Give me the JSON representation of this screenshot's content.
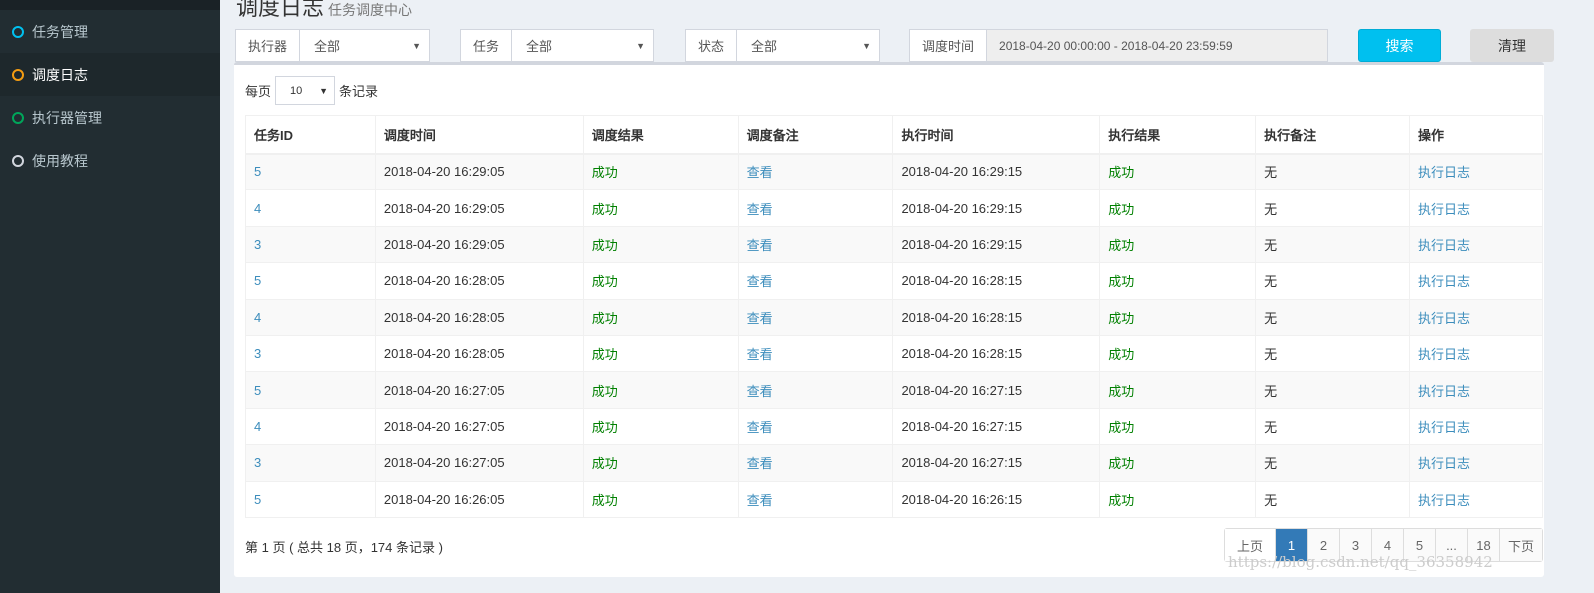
{
  "sidebar": {
    "items": [
      {
        "label": "任务管理",
        "color": "#00c0ef"
      },
      {
        "label": "调度日志",
        "color": "#f39c12"
      },
      {
        "label": "执行器管理",
        "color": "#00a65a"
      },
      {
        "label": "使用教程",
        "color": "#d2d6de"
      }
    ]
  },
  "header": {
    "title": "调度日志",
    "subtitle": "任务调度中心"
  },
  "filters": {
    "executor_label": "执行器",
    "executor_value": "全部",
    "job_label": "任务",
    "job_value": "全部",
    "status_label": "状态",
    "status_value": "全部",
    "time_label": "调度时间",
    "time_value": "2018-04-20 00:00:00 - 2018-04-20 23:59:59",
    "search": "搜索",
    "clear": "清理"
  },
  "page_size": {
    "prefix": "每页",
    "value": "10",
    "suffix": "条记录"
  },
  "table": {
    "headers": [
      "任务ID",
      "调度时间",
      "调度结果",
      "调度备注",
      "执行时间",
      "执行结果",
      "执行备注",
      "操作"
    ],
    "rows": [
      [
        "5",
        "2018-04-20 16:29:05",
        "成功",
        "查看",
        "2018-04-20 16:29:15",
        "成功",
        "无",
        "执行日志"
      ],
      [
        "4",
        "2018-04-20 16:29:05",
        "成功",
        "查看",
        "2018-04-20 16:29:15",
        "成功",
        "无",
        "执行日志"
      ],
      [
        "3",
        "2018-04-20 16:29:05",
        "成功",
        "查看",
        "2018-04-20 16:29:15",
        "成功",
        "无",
        "执行日志"
      ],
      [
        "5",
        "2018-04-20 16:28:05",
        "成功",
        "查看",
        "2018-04-20 16:28:15",
        "成功",
        "无",
        "执行日志"
      ],
      [
        "4",
        "2018-04-20 16:28:05",
        "成功",
        "查看",
        "2018-04-20 16:28:15",
        "成功",
        "无",
        "执行日志"
      ],
      [
        "3",
        "2018-04-20 16:28:05",
        "成功",
        "查看",
        "2018-04-20 16:28:15",
        "成功",
        "无",
        "执行日志"
      ],
      [
        "5",
        "2018-04-20 16:27:05",
        "成功",
        "查看",
        "2018-04-20 16:27:15",
        "成功",
        "无",
        "执行日志"
      ],
      [
        "4",
        "2018-04-20 16:27:05",
        "成功",
        "查看",
        "2018-04-20 16:27:15",
        "成功",
        "无",
        "执行日志"
      ],
      [
        "3",
        "2018-04-20 16:27:05",
        "成功",
        "查看",
        "2018-04-20 16:27:15",
        "成功",
        "无",
        "执行日志"
      ],
      [
        "5",
        "2018-04-20 16:26:05",
        "成功",
        "查看",
        "2018-04-20 16:26:15",
        "成功",
        "无",
        "执行日志"
      ]
    ]
  },
  "footer": {
    "info": "第 1 页 ( 总共 18 页，174 条记录 )"
  },
  "pagination": [
    "上页",
    "1",
    "2",
    "3",
    "4",
    "5",
    "...",
    "18",
    "下页"
  ],
  "watermark": "https://blog.csdn.net/qq_36358942"
}
